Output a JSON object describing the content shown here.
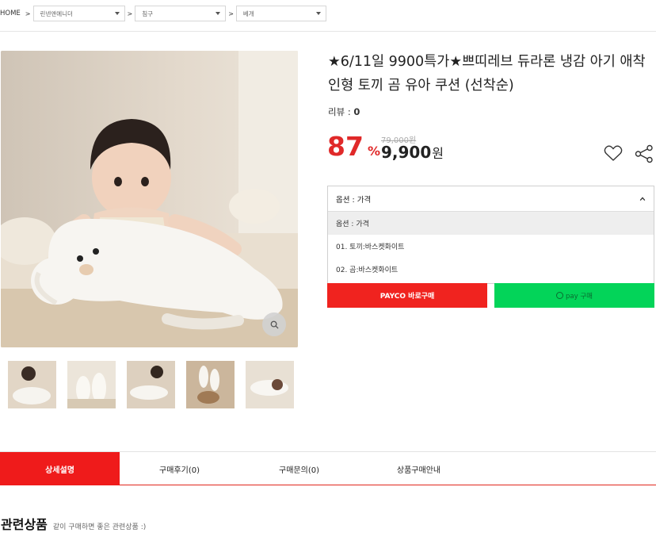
{
  "breadcrumb": {
    "home": "HOME",
    "sep": ">",
    "levels": [
      "린넨앤에니더",
      "침구",
      "베개"
    ]
  },
  "product": {
    "title": "★6/11일 9900특가★쁘띠레브 듀라론 냉감 아기 애착인형 토끼 곰 유아 쿠션 (선착순)",
    "review_label": "리뷰 : ",
    "review_count": "0",
    "discount_percent": "87",
    "percent_sign": "%",
    "original_price": "79,000원",
    "sale_price": "9,900",
    "currency": "원"
  },
  "options": {
    "header": "옵션 : 가격",
    "items": [
      "옵션 : 가격",
      "01. 토끼:바스켓화이트",
      "02. 곰:바스켓화이트"
    ],
    "selected_index": 0
  },
  "buttons": {
    "payco": "PAYCO 바로구매",
    "npay": "pay 구매"
  },
  "icons": {
    "heart": "heart-icon",
    "share": "share-icon",
    "zoom": "search-icon",
    "option_chevron": "chevron-up-icon"
  },
  "tabs": [
    "상세설명",
    "구매후기(0)",
    "구매문의(0)",
    "상품구매안내"
  ],
  "related": {
    "title": "관련상품",
    "subtitle": "같이 구매하면 좋은 관련상품 :)"
  },
  "colors": {
    "accent_red": "#ef1b1b",
    "npay_green": "#03d459",
    "discount_red": "#e02929"
  }
}
